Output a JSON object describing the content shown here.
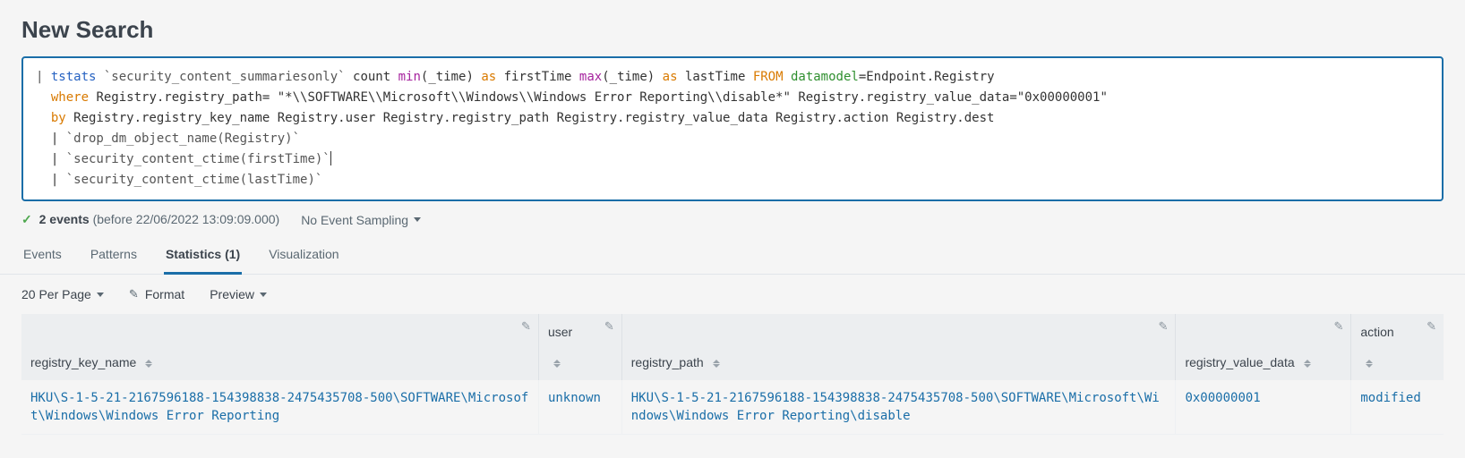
{
  "title": "New Search",
  "search": {
    "line1": {
      "pipe": "| ",
      "cmd": "tstats",
      "sp1": " ",
      "macro": "`security_content_summariesonly`",
      "sp2": " count ",
      "func1": "min",
      "arg1": "(_time) ",
      "as1": "as",
      "name1": " firstTime ",
      "func2": "max",
      "arg2": "(_time) ",
      "as2": "as",
      "name2": " lastTime ",
      "from": "FROM",
      "sp3": " ",
      "dm": "datamodel",
      "rest": "=Endpoint.Registry"
    },
    "line2": {
      "indent": "  ",
      "where": "where",
      "rest": " Registry.registry_path= \"*\\\\SOFTWARE\\\\Microsoft\\\\Windows\\\\Windows Error Reporting\\\\disable*\" Registry.registry_value_data=\"0x00000001\""
    },
    "line3": {
      "indent": "  ",
      "by": "by",
      "rest": " Registry.registry_key_name Registry.user Registry.registry_path Registry.registry_value_data Registry.action Registry.dest"
    },
    "line4": {
      "indent": "  | ",
      "macro": "`drop_dm_object_name(Registry)`"
    },
    "line5": {
      "indent": "  | ",
      "macro": "`security_content_ctime(firstTime)`"
    },
    "line6": {
      "indent": "  | ",
      "macro": "`security_content_ctime(lastTime)`"
    }
  },
  "status": {
    "events_count": "2 events",
    "before": " (before 22/06/2022 13:09:09.000)",
    "sampling": "No Event Sampling"
  },
  "tabs": {
    "events": "Events",
    "patterns": "Patterns",
    "statistics": "Statistics (1)",
    "visualization": "Visualization"
  },
  "toolbar": {
    "per_page": "20 Per Page",
    "format": "Format",
    "preview": "Preview"
  },
  "table": {
    "headers": {
      "registry_key_name": "registry_key_name",
      "user": "user",
      "registry_path": "registry_path",
      "registry_value_data": "registry_value_data",
      "action": "action"
    },
    "rows": [
      {
        "registry_key_name": "HKU\\S-1-5-21-2167596188-154398838-2475435708-500\\SOFTWARE\\Microsoft\\Windows\\Windows Error Reporting",
        "user": "unknown",
        "registry_path": "HKU\\S-1-5-21-2167596188-154398838-2475435708-500\\SOFTWARE\\Microsoft\\Windows\\Windows Error Reporting\\disable",
        "registry_value_data": "0x00000001",
        "action": "modified"
      }
    ]
  }
}
